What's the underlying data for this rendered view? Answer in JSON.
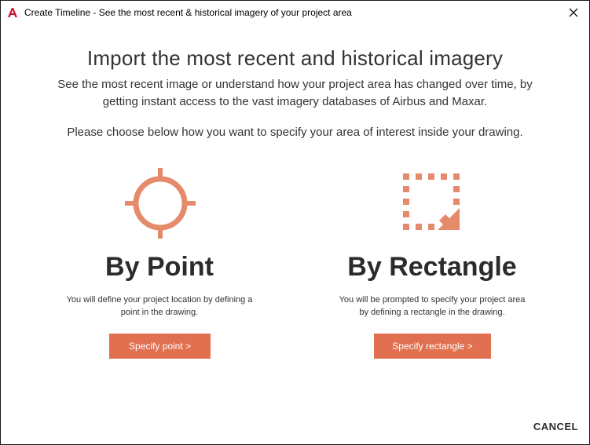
{
  "window": {
    "title": "Create Timeline - See the most recent & historical imagery of your project area",
    "app_icon": "autocad-a-icon",
    "close_icon": "close-icon"
  },
  "heading": "Import the most recent and historical imagery",
  "description": {
    "line1": "See the most recent image or understand how your project area has changed over time, by",
    "line2": "getting instant access to the vast imagery databases of Airbus and Maxar."
  },
  "instruction": "Please choose below how you want to specify your area of interest inside your drawing.",
  "options": {
    "point": {
      "icon": "crosshair-icon",
      "title": "By Point",
      "desc_line1": "You will define your project location by defining a",
      "desc_line2": "point in the drawing.",
      "button": "Specify point >"
    },
    "rectangle": {
      "icon": "rectangle-select-icon",
      "title": "By Rectangle",
      "desc_line1": "You will be prompted to specify your project area",
      "desc_line2": "by defining a rectangle in the drawing.",
      "button": "Specify rectangle >"
    }
  },
  "footer": {
    "cancel": "CANCEL"
  },
  "colors": {
    "accent": "#e07050",
    "icon": "#e58a6b",
    "app_icon_red": "#c8102e"
  }
}
